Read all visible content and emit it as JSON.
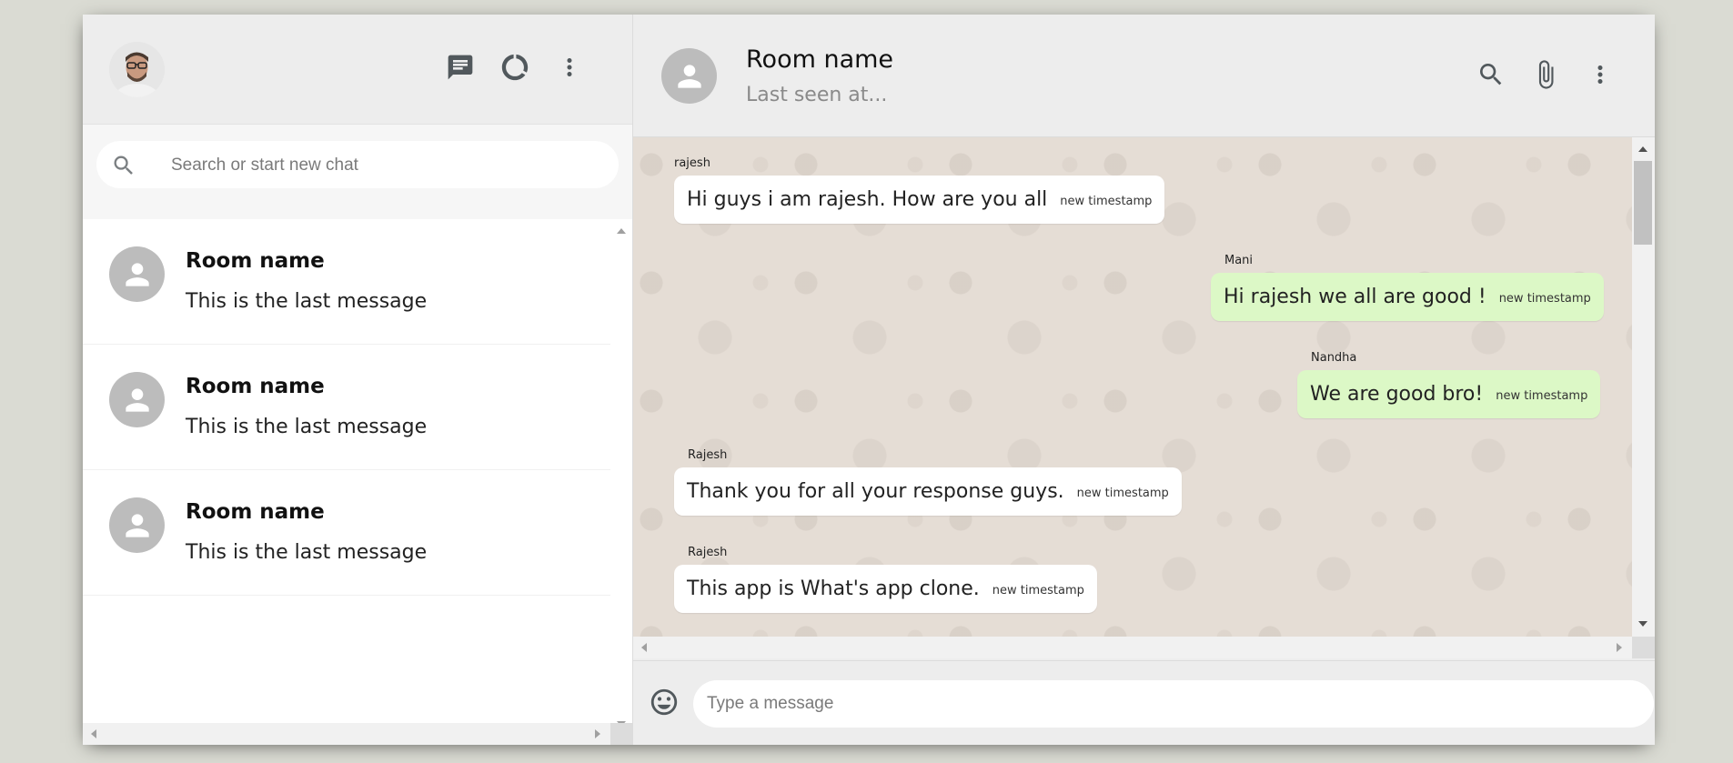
{
  "sidebar": {
    "search_placeholder": "Search or start new chat",
    "icons": [
      "chat-icon",
      "status-icon",
      "more-vert-icon"
    ],
    "chats": [
      {
        "name": "Room name",
        "last_message": "This is the last message"
      },
      {
        "name": "Room name",
        "last_message": "This is the last message"
      },
      {
        "name": "Room name",
        "last_message": "This is the last message"
      }
    ]
  },
  "chat_header": {
    "room_name": "Room name",
    "last_seen": "Last seen at...",
    "icons": [
      "search-icon",
      "attach-icon",
      "more-vert-icon"
    ]
  },
  "messages": [
    {
      "sender": "rajesh",
      "text": "Hi guys i am rajesh. How are you all",
      "timestamp": "new timestamp",
      "outgoing": false
    },
    {
      "sender": "Mani",
      "text": "Hi rajesh we all are good !",
      "timestamp": "new timestamp",
      "outgoing": true
    },
    {
      "sender": "Nandha",
      "text": "We are good bro!",
      "timestamp": "new timestamp",
      "outgoing": true
    },
    {
      "sender": "Rajesh",
      "text": "Thank you for all your response guys.",
      "timestamp": "new timestamp",
      "outgoing": false
    },
    {
      "sender": "Rajesh",
      "text": "This app is What's app clone.",
      "timestamp": "new timestamp",
      "outgoing": false
    }
  ],
  "footer": {
    "input_placeholder": "Type a message"
  },
  "colors": {
    "background": "#dadbd3",
    "panel": "#ededed",
    "chat_bg": "#e5ddd5",
    "outgoing_bubble": "#dcf8c6",
    "incoming_bubble": "#ffffff",
    "avatar_placeholder": "#bcbcbc"
  }
}
